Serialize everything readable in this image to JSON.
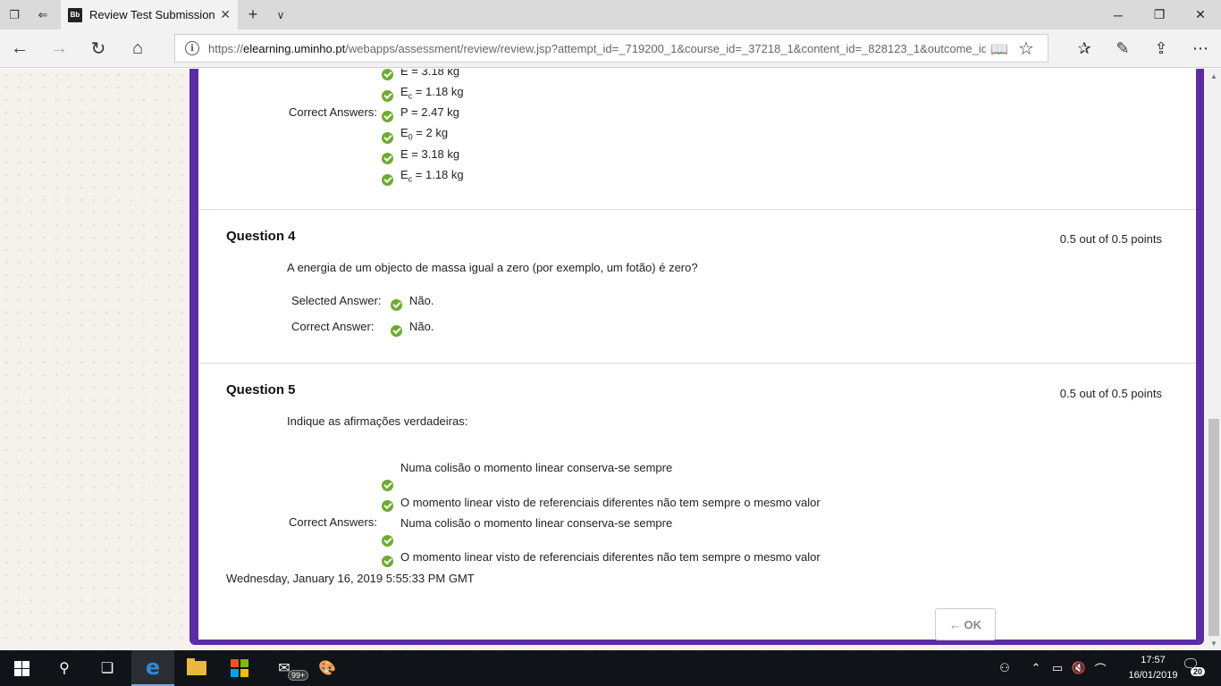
{
  "browser": {
    "tab_title": "Review Test Submission",
    "tab_logo": "Bb",
    "url_domain": "elearning.uminho.pt",
    "url_prefix": "https://",
    "url_path": "/webapps/assessment/review/review.jsp?attempt_id=_719200_1&course_id=_37218_1&content_id=_828123_1&outcome_id"
  },
  "question3_tail": {
    "selected_partial": [
      "E = 3.18 kg",
      "Ec = 1.18 kg"
    ],
    "correct_label": "Correct Answers:",
    "correct_answers": [
      {
        "main": "P = 2.47 kg",
        "sub": ""
      },
      {
        "main": "E",
        "sub": "0",
        "rest": " = 2 kg"
      },
      {
        "main": "E = 3.18 kg",
        "sub": ""
      },
      {
        "main": "E",
        "sub": "c",
        "rest": " = 1.18 kg"
      }
    ]
  },
  "question4": {
    "title": "Question 4",
    "points": "0.5 out of 0.5 points",
    "text": "A energia de um objecto de massa igual a zero (por exemplo, um fotão) é zero?",
    "selected_label": "Selected Answer:",
    "selected_value": "Não.",
    "correct_label": "Correct Answer:",
    "correct_value": "Não."
  },
  "question5": {
    "title": "Question 5",
    "points": "0.5 out of 0.5 points",
    "text": "Indique as afirmações verdadeiras:",
    "selected": [
      "Numa colisão o momento linear conserva-se sempre",
      "O momento linear visto de referenciais diferentes não tem sempre o mesmo valor"
    ],
    "correct_label": "Correct Answers:",
    "correct": [
      "Numa colisão o momento linear conserva-se sempre",
      "O momento linear visto de referenciais diferentes não tem sempre o mesmo valor"
    ]
  },
  "footer": {
    "date": "Wednesday, January 16, 2019 5:55:33 PM GMT",
    "ok_label": "← OK"
  },
  "taskbar": {
    "mail_badge": "99+",
    "time": "17:57",
    "date": "16/01/2019",
    "notification_count": "20"
  },
  "colors": {
    "panel_border": "#5b2ca3",
    "check_green": "#6dac2c",
    "taskbar": "#101317"
  }
}
